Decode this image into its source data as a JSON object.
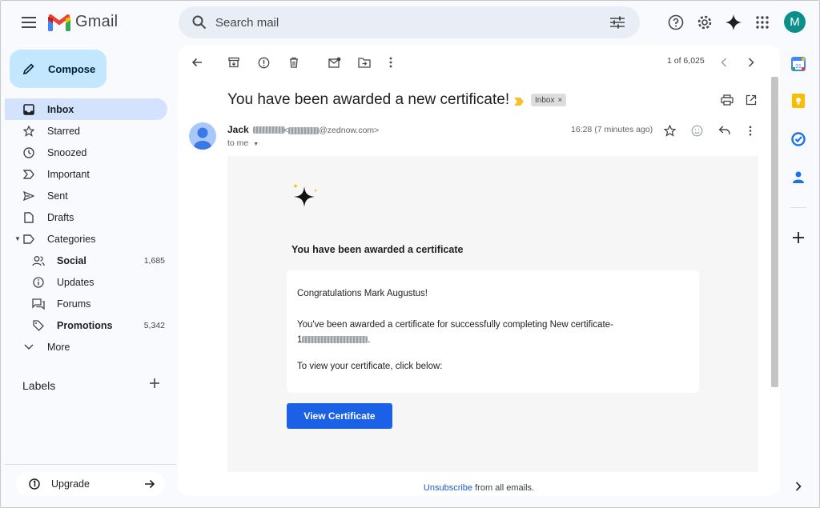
{
  "app": {
    "name": "Gmail"
  },
  "search": {
    "placeholder": "Search mail"
  },
  "user": {
    "avatar_letter": "M"
  },
  "compose": {
    "label": "Compose"
  },
  "nav": {
    "inbox": "Inbox",
    "starred": "Starred",
    "snoozed": "Snoozed",
    "important": "Important",
    "sent": "Sent",
    "drafts": "Drafts",
    "categories": "Categories",
    "social": "Social",
    "social_count": "1,685",
    "updates": "Updates",
    "forums": "Forums",
    "promotions": "Promotions",
    "promotions_count": "5,342",
    "more": "More"
  },
  "labels": {
    "heading": "Labels"
  },
  "upgrade": {
    "label": "Upgrade"
  },
  "pager": {
    "text": "1 of 6,025"
  },
  "email": {
    "subject": "You have been awarded a new certificate!",
    "chip": "Inbox",
    "chip_close": "×",
    "sender_name": "Jack",
    "sender_email_domain": "@zednow.com>",
    "sender_email_prefix": "<",
    "to": "to me",
    "time": "16:28 (7 minutes ago)",
    "body_heading": "You have been awarded a certificate",
    "greeting": "Congratulations Mark Augustus!",
    "line1": "You've been awarded a certificate for successfully completing New certificate-",
    "line1b_prefix": "1",
    "line1b_suffix": ".",
    "line2": "To view your certificate, click below:",
    "cta": "View Certificate",
    "footer_link": "Unsubscribe",
    "footer_text": " from all emails."
  },
  "colors": {
    "compose_bg": "#c2e7ff",
    "active_nav": "#d3e3fd",
    "cta": "#1a61e6",
    "avatar": "#0b8f8a"
  }
}
